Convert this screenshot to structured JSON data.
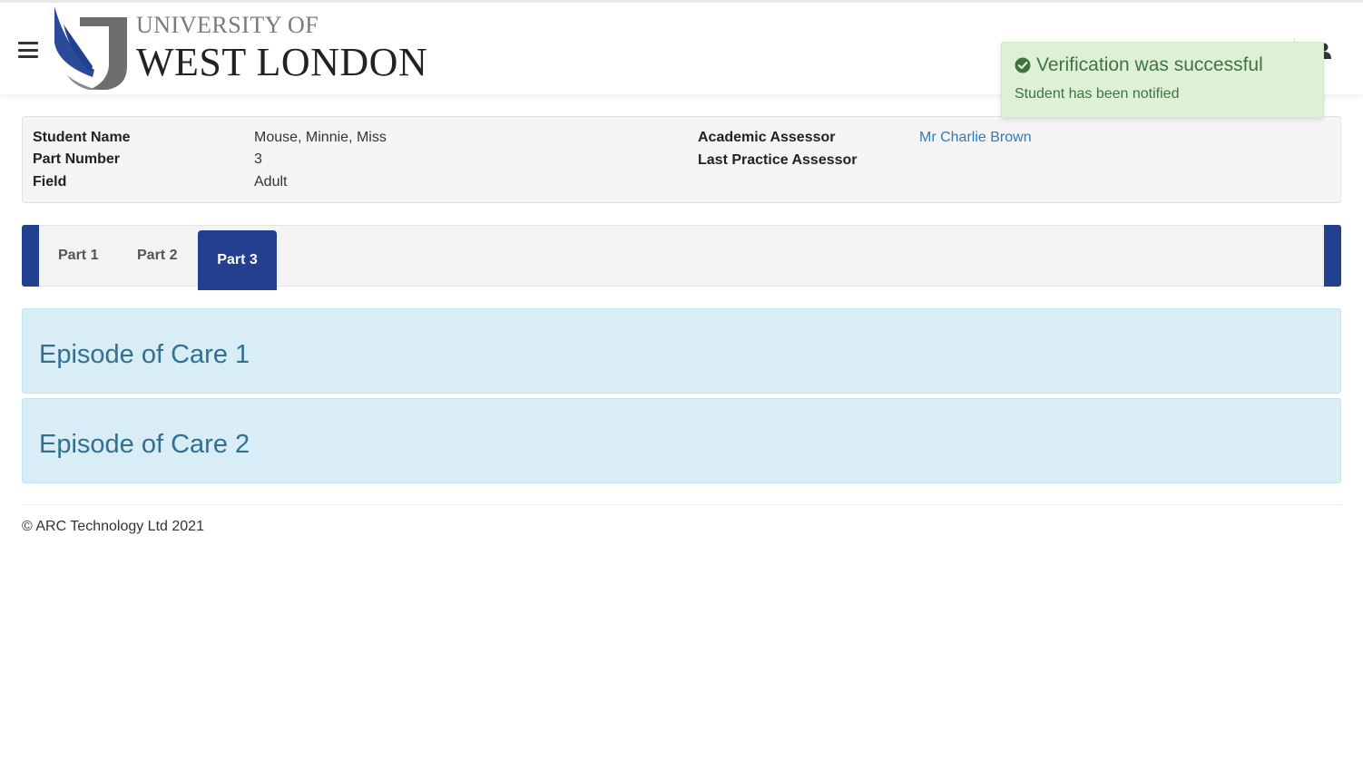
{
  "header": {
    "logo_line1": "UNIVERSITY OF",
    "logo_line2": "WEST LONDON",
    "menu_icon": "hamburger-icon",
    "user_icon": "user-icon"
  },
  "toast": {
    "icon": "check-circle-icon",
    "title": "Verification was successful",
    "message": "Student has been notified",
    "color": "#3c763d"
  },
  "student": {
    "name_label": "Student Name",
    "name_value": "Mouse, Minnie, Miss",
    "part_label": "Part Number",
    "part_value": "3",
    "field_label": "Field",
    "field_value": "Adult",
    "academic_label": "Academic Assessor",
    "academic_value": "Mr Charlie Brown",
    "practice_label": "Last Practice Assessor",
    "practice_value": ""
  },
  "tabs": [
    {
      "label": "Part 1",
      "active": false
    },
    {
      "label": "Part 2",
      "active": false
    },
    {
      "label": "Part 3",
      "active": true
    }
  ],
  "episodes": [
    {
      "title": "Episode of Care 1"
    },
    {
      "title": "Episode of Care 2"
    }
  ],
  "footer": {
    "copyright": "© ARC Technology Ltd 2021"
  },
  "colors": {
    "brand_navy": "#233f8f",
    "info_blue_bg": "#d9edf7",
    "info_blue_text": "#31708f",
    "success_bg": "#dff0d8",
    "link": "#337ab7"
  }
}
